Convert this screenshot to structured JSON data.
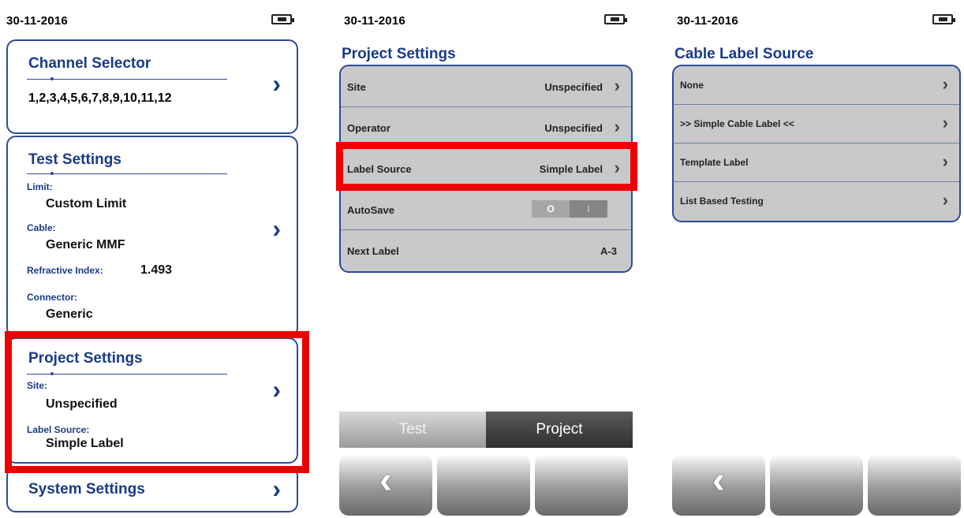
{
  "screen1": {
    "date": "30-11-2016",
    "channel_selector": {
      "title": "Channel Selector",
      "value": "1,2,3,4,5,6,7,8,9,10,11,12"
    },
    "test_settings": {
      "title": "Test Settings",
      "limit_label": "Limit:",
      "limit_value": "Custom Limit",
      "cable_label": "Cable:",
      "cable_value": "Generic MMF",
      "ri_label": "Refractive Index:",
      "ri_value": "1.493",
      "connector_label": "Connector:",
      "connector_value": "Generic"
    },
    "project_settings": {
      "title": "Project Settings",
      "site_label": "Site:",
      "site_value": "Unspecified",
      "label_source_label": "Label Source:",
      "label_source_value": "Simple Label"
    },
    "system_settings": {
      "title": "System Settings"
    },
    "chevron_glyph": "›"
  },
  "screen2": {
    "date": "30-11-2016",
    "heading": "Project Settings",
    "rows": [
      {
        "label": "Site",
        "value": "Unspecified"
      },
      {
        "label": "Operator",
        "value": "Unspecified"
      },
      {
        "label": "Label Source",
        "value": "Simple Label"
      },
      {
        "label": "AutoSave",
        "toggle_off": "O",
        "toggle_on": "I"
      },
      {
        "label": "Next Label",
        "value": "A-3"
      }
    ],
    "tabs": {
      "test": "Test",
      "project": "Project"
    },
    "back_glyph": "‹",
    "row_chevron": "›"
  },
  "screen3": {
    "date": "30-11-2016",
    "heading": "Cable Label Source",
    "rows": [
      {
        "label": "None"
      },
      {
        "label": ">> Simple Cable Label <<"
      },
      {
        "label": "Template Label"
      },
      {
        "label": "List Based Testing"
      }
    ],
    "back_glyph": "‹",
    "row_chevron": "›"
  },
  "colors": {
    "accent": "#1a3a8a",
    "border": "#2d4a9a",
    "highlight": "#ee0000",
    "list_bg": "#c9c9c9"
  }
}
